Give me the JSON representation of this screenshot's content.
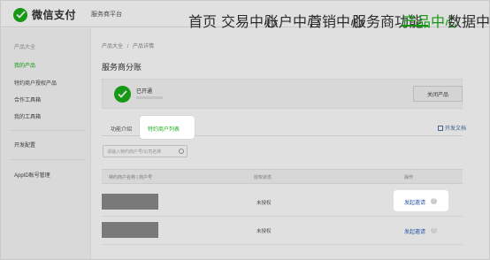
{
  "brand": {
    "name": "微信支付",
    "platform": "服务商平台"
  },
  "nav": [
    {
      "label": "首页",
      "active": false
    },
    {
      "label": "交易中心",
      "active": false
    },
    {
      "label": "账户中心",
      "active": false
    },
    {
      "label": "营销中心",
      "active": false
    },
    {
      "label": "服务商功能",
      "active": false
    },
    {
      "label": "产品中心",
      "active": true
    },
    {
      "label": "数据中心",
      "active": false
    }
  ],
  "sidebar": {
    "items": [
      {
        "label": "产品大全"
      },
      {
        "label": "我的产品"
      },
      {
        "label": "特约商户授权产品"
      },
      {
        "label": "合作工具箱"
      },
      {
        "label": "我的工具箱"
      },
      {
        "label": "开发配置"
      },
      {
        "label": "AppID账号管理"
      }
    ]
  },
  "breadcrumb": {
    "parent": "产品大全",
    "separator": "/",
    "current": "产品详情"
  },
  "page_title": "服务商分账",
  "status": {
    "label": "已开通",
    "close_button": "关闭产品"
  },
  "tabs": [
    {
      "label": "功能介绍",
      "active": false
    },
    {
      "label": "特约商户列表",
      "active": true
    }
  ],
  "doc_link": "开发文档",
  "search": {
    "placeholder": "请输入特约商户号/公司名称"
  },
  "table": {
    "headers": [
      "特约商户名称 | 商户号",
      "授权状态",
      "操作"
    ],
    "rows": [
      {
        "status": "未授权",
        "action": "发起邀请"
      },
      {
        "status": "未授权",
        "action": "发起邀请"
      }
    ]
  },
  "colors": {
    "accent": "#1aad19",
    "link": "#2b57a6"
  }
}
